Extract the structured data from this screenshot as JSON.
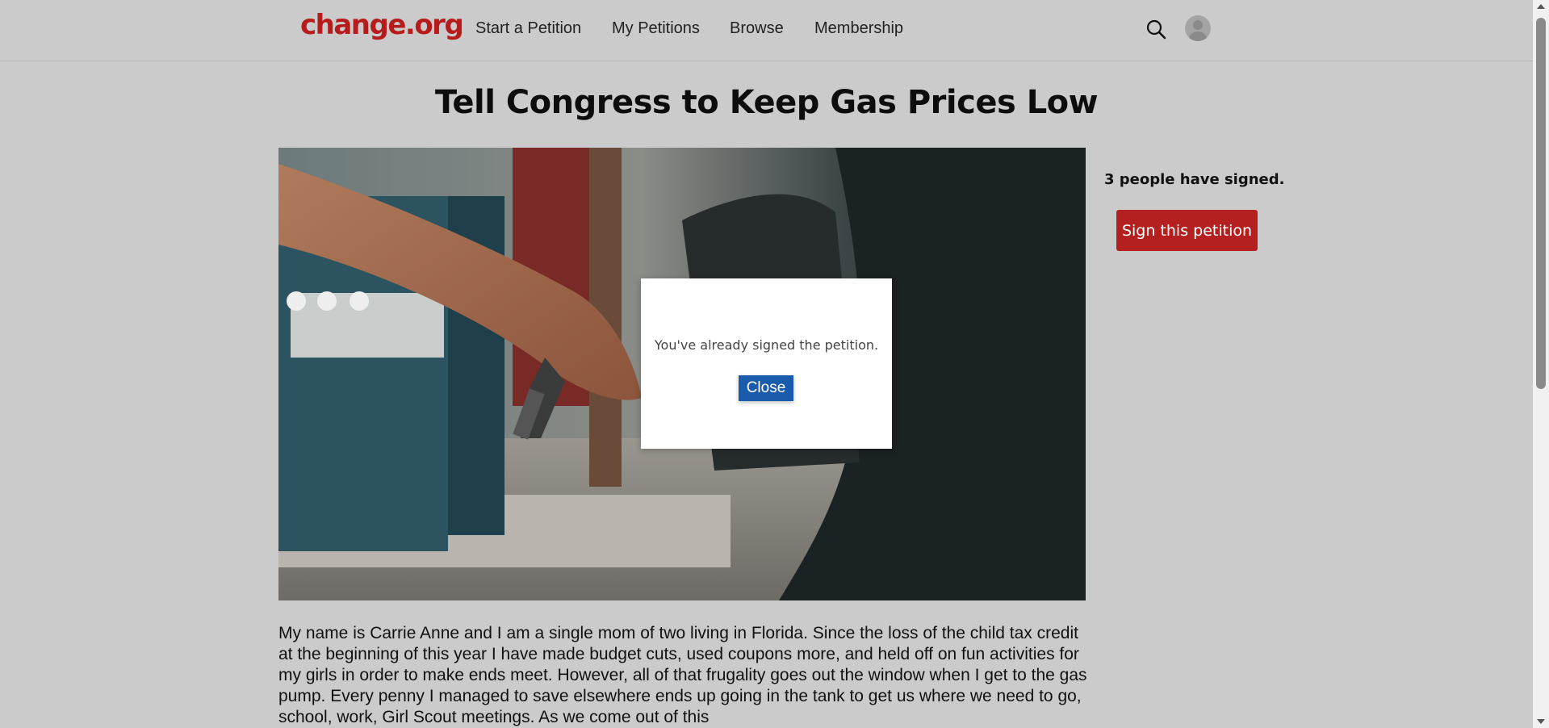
{
  "header": {
    "logo": "change.org",
    "nav": [
      "Start a Petition",
      "My Petitions",
      "Browse",
      "Membership"
    ]
  },
  "petition": {
    "title": "Tell Congress to Keep Gas Prices Low",
    "signed_count": "3 people have signed.",
    "sign_label": "Sign this petition",
    "body": "My name is Carrie Anne and I am a single mom of two living in Florida. Since the loss of the child tax credit at the beginning of this year I have made budget cuts, used coupons more, and held off on fun activities for my girls in order to make ends meet. However, all of that frugality goes out the window when I get to the gas pump. Every penny I managed to save elsewhere ends up going in the tank to get us where we need to go, school, work, Girl Scout meetings. As we come out of this"
  },
  "modal": {
    "message": "You've already signed the petition.",
    "close_label": "Close"
  },
  "colors": {
    "brand": "#b71c1c",
    "sign_button": "#b4201f",
    "close_button": "#1a5bab"
  },
  "icons": {
    "search": "search-icon",
    "avatar": "user-avatar-icon"
  }
}
